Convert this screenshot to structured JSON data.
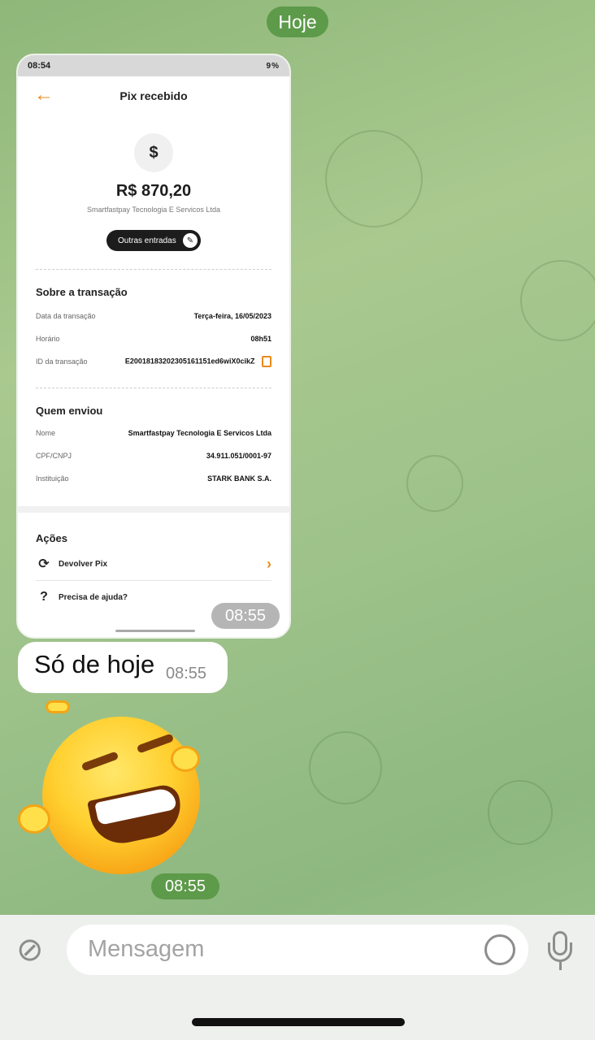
{
  "chat": {
    "date_label": "Hoje",
    "screenshot_time": "08:55",
    "text_message": "Só de hoje",
    "text_time": "08:55",
    "sticker_time": "08:55"
  },
  "screenshot": {
    "status_time": "08:54",
    "status_right": "9%",
    "title": "Pix recebido",
    "amount": "R$ 870,20",
    "company": "Smartfastpay Tecnologia E Servicos Ltda",
    "other_button": "Outras entradas",
    "section_transaction": "Sobre a transação",
    "transaction": [
      {
        "label": "Data da transação",
        "value": "Terça-feira, 16/05/2023"
      },
      {
        "label": "Horário",
        "value": "08h51"
      },
      {
        "label": "ID da transação",
        "value": "E20018183202305161151ed6wiX0cikZ"
      }
    ],
    "section_sender": "Quem enviou",
    "sender": [
      {
        "label": "Nome",
        "value": "Smartfastpay Tecnologia E Servicos Ltda"
      },
      {
        "label": "CPF/CNPJ",
        "value": "34.911.051/0001-97"
      },
      {
        "label": "Instituição",
        "value": "STARK BANK S.A."
      }
    ],
    "section_actions": "Ações",
    "actions": [
      {
        "label": "Devolver Pix"
      },
      {
        "label": "Precisa de ajuda?"
      }
    ]
  },
  "input": {
    "placeholder": "Mensagem"
  },
  "icons": {
    "attach": "paperclip-icon",
    "sticker": "sticker-icon",
    "mic": "microphone-icon"
  },
  "colors": {
    "accent_orange": "#e98a1b",
    "date_pill_green": "#5d9a4a"
  }
}
